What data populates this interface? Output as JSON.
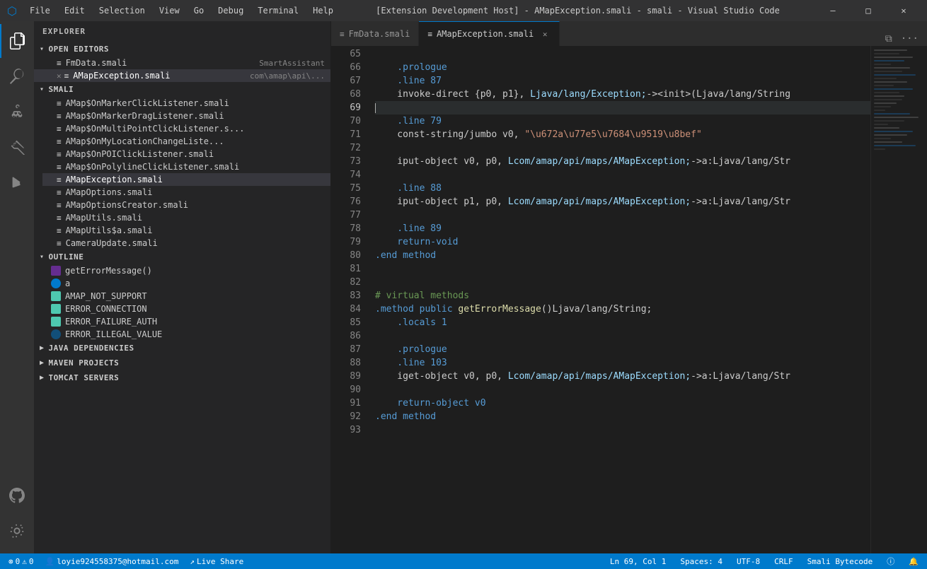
{
  "titlebar": {
    "menu_items": [
      "File",
      "Edit",
      "Selection",
      "View",
      "Go",
      "Debug",
      "Terminal",
      "Help"
    ],
    "title": "[Extension Development Host] - AMapException.smali - smali - Visual Studio Code",
    "min": "—",
    "max": "□",
    "close": "✕"
  },
  "sidebar": {
    "title": "EXPLORER",
    "open_editors_label": "OPEN EDITORS",
    "files": [
      {
        "name": "FmData.smali",
        "desc": "SmartAssistant",
        "active": false,
        "modified": false
      },
      {
        "name": "AMapException.smali",
        "desc": "com\\amap\\api\\...",
        "active": true,
        "modified": false
      }
    ],
    "smali_label": "SMALI",
    "smali_files": [
      "AMap$OnMarkerClickListener.smali",
      "AMap$OnMarkerDragListener.smali",
      "AMap$OnMultiPointClickListener.s...",
      "AMap$OnMyLocationChangeListe...",
      "AMap$OnPOIClickListener.smali",
      "AMap$OnPolylineClickListener.smali",
      "AMapException.smali",
      "AMapOptions.smali",
      "AMapOptionsCreator.smali",
      "AMapUtils.smali",
      "AMapUtils$a.smali",
      "CameraUpdate.smali"
    ],
    "outline_label": "OUTLINE",
    "outline_items": [
      {
        "name": "getErrorMessage()",
        "type": "method"
      },
      {
        "name": "a",
        "type": "field"
      },
      {
        "name": "AMAP_NOT_SUPPORT",
        "type": "enum"
      },
      {
        "name": "ERROR_CONNECTION",
        "type": "enum"
      },
      {
        "name": "ERROR_FAILURE_AUTH",
        "type": "enum"
      },
      {
        "name": "ERROR_ILLEGAL_VALUE",
        "type": "enum"
      }
    ],
    "java_deps_label": "JAVA DEPENDENCIES",
    "maven_label": "MAVEN PROJECTS",
    "tomcat_label": "TOMCAT SERVERS"
  },
  "tabs": [
    {
      "name": "FmData.smali",
      "active": false
    },
    {
      "name": "AMapException.smali",
      "active": true
    }
  ],
  "editor": {
    "lines": [
      {
        "num": 65,
        "content": ""
      },
      {
        "num": 66,
        "tokens": [
          {
            "t": "    .prologue",
            "c": "kw-directive"
          }
        ]
      },
      {
        "num": 67,
        "tokens": [
          {
            "t": "    .line 87",
            "c": "kw-directive"
          }
        ]
      },
      {
        "num": 68,
        "tokens": [
          {
            "t": "    invoke-direct {p0, p1}, ",
            "c": ""
          },
          {
            "t": "Ljava/lang/Exception;",
            "c": "kw-light"
          },
          {
            "t": "-><init>(Ljava/lang/String",
            "c": ""
          }
        ]
      },
      {
        "num": 69,
        "content": "",
        "current": true
      },
      {
        "num": 70,
        "tokens": [
          {
            "t": "    .line 79",
            "c": "kw-directive"
          }
        ]
      },
      {
        "num": 71,
        "tokens": [
          {
            "t": "    const-string/jumbo v0, ",
            "c": ""
          },
          {
            "t": "\"\\u672a\\u77e5\\u7684\\u9519\\u8bef\"",
            "c": "kw-string"
          }
        ]
      },
      {
        "num": 72,
        "content": ""
      },
      {
        "num": 73,
        "tokens": [
          {
            "t": "    iput-object v0, p0, ",
            "c": ""
          },
          {
            "t": "Lcom/amap/api/maps/AMapException;",
            "c": "kw-light"
          },
          {
            "t": "->a:Ljava/lang/Str",
            "c": ""
          }
        ]
      },
      {
        "num": 74,
        "content": ""
      },
      {
        "num": 75,
        "tokens": [
          {
            "t": "    .line 88",
            "c": "kw-directive"
          }
        ]
      },
      {
        "num": 76,
        "tokens": [
          {
            "t": "    iput-object p1, p0, ",
            "c": ""
          },
          {
            "t": "Lcom/amap/api/maps/AMapException;",
            "c": "kw-light"
          },
          {
            "t": "->a:Ljava/lang/Str",
            "c": ""
          }
        ]
      },
      {
        "num": 77,
        "content": ""
      },
      {
        "num": 78,
        "tokens": [
          {
            "t": "    .line 89",
            "c": "kw-directive"
          }
        ]
      },
      {
        "num": 79,
        "tokens": [
          {
            "t": "    return-void",
            "c": "kw-directive"
          }
        ]
      },
      {
        "num": 80,
        "tokens": [
          {
            "t": ".end method",
            "c": "kw-directive"
          }
        ]
      },
      {
        "num": 81,
        "content": ""
      },
      {
        "num": 82,
        "content": ""
      },
      {
        "num": 83,
        "tokens": [
          {
            "t": "# virtual methods",
            "c": "kw-green"
          }
        ]
      },
      {
        "num": 84,
        "tokens": [
          {
            "t": ".method ",
            "c": "kw-directive"
          },
          {
            "t": "public ",
            "c": "kw-blue"
          },
          {
            "t": "getErrorMessage",
            "c": "kw-yellow"
          },
          {
            "t": "()Ljava/lang/String;",
            "c": ""
          }
        ]
      },
      {
        "num": 85,
        "tokens": [
          {
            "t": "    .locals 1",
            "c": "kw-directive"
          }
        ]
      },
      {
        "num": 86,
        "content": ""
      },
      {
        "num": 87,
        "tokens": [
          {
            "t": "    .prologue",
            "c": "kw-directive"
          }
        ]
      },
      {
        "num": 88,
        "tokens": [
          {
            "t": "    .line 103",
            "c": "kw-directive"
          }
        ]
      },
      {
        "num": 89,
        "tokens": [
          {
            "t": "    iget-object v0, p0, ",
            "c": ""
          },
          {
            "t": "Lcom/amap/api/maps/AMapException;",
            "c": "kw-light"
          },
          {
            "t": "->a:Ljava/lang/Str",
            "c": ""
          }
        ]
      },
      {
        "num": 90,
        "content": ""
      },
      {
        "num": 91,
        "tokens": [
          {
            "t": "    return-object v0",
            "c": "kw-directive"
          }
        ]
      },
      {
        "num": 92,
        "tokens": [
          {
            "t": ".end method",
            "c": "kw-directive"
          }
        ]
      },
      {
        "num": 93,
        "content": ""
      }
    ]
  },
  "status": {
    "errors": "0",
    "warnings": "0",
    "left": [
      {
        "icon": "⚠",
        "text": "0"
      },
      {
        "icon": "⊗",
        "text": "0"
      }
    ],
    "user": "loyie924558375@hotmail.com",
    "live_share": "Live Share",
    "position": "Ln 69, Col 1",
    "spaces": "Spaces: 4",
    "encoding": "UTF-8",
    "eol": "CRLF",
    "language": "Smali Bytecode",
    "bell": "🔔",
    "info": "ⓘ"
  }
}
